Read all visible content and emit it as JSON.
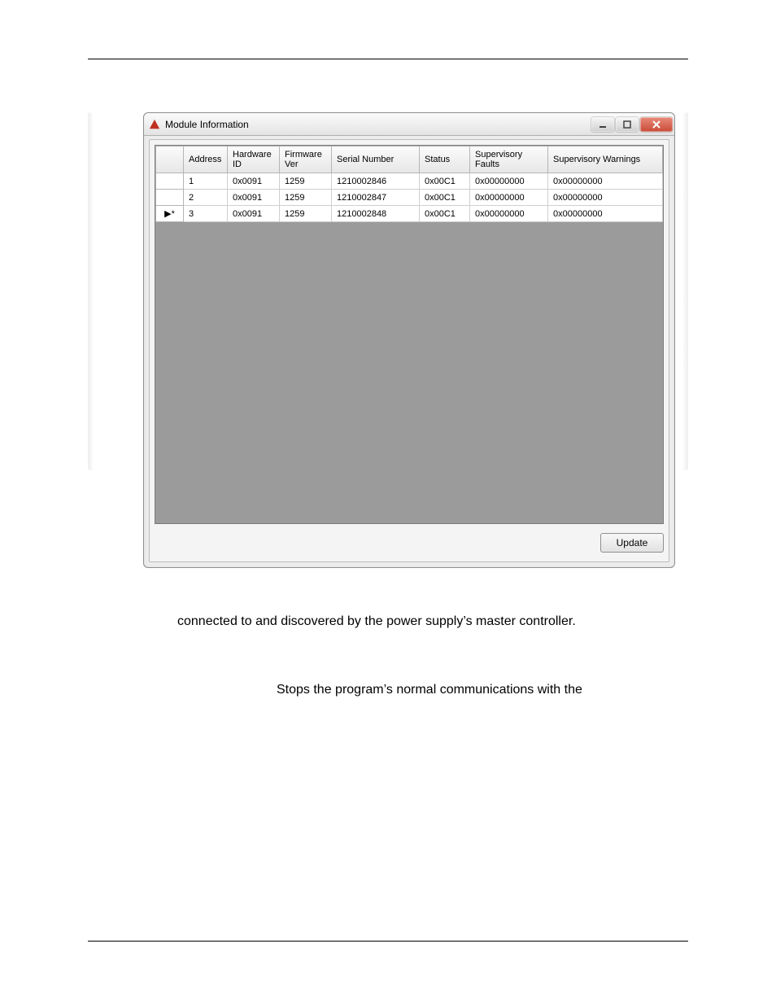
{
  "window": {
    "title": "Module Information",
    "update_button": "Update"
  },
  "columns": {
    "rowheader": "",
    "address": "Address",
    "hardware_id": "Hardware ID",
    "firmware_ver": "Firmware Ver",
    "serial_number": "Serial Number",
    "status": "Status",
    "supervisory_faults": "Supervisory Faults",
    "supervisory_warnings": "Supervisory Warnings"
  },
  "rows": [
    {
      "marker": "",
      "address": "1",
      "hardware_id": "0x0091",
      "firmware_ver": "1259",
      "serial_number": "1210002846",
      "status": "0x00C1",
      "supervisory_faults": "0x00000000",
      "supervisory_warnings": "0x00000000"
    },
    {
      "marker": "",
      "address": "2",
      "hardware_id": "0x0091",
      "firmware_ver": "1259",
      "serial_number": "1210002847",
      "status": "0x00C1",
      "supervisory_faults": "0x00000000",
      "supervisory_warnings": "0x00000000"
    },
    {
      "marker": "▶*",
      "address": "3",
      "hardware_id": "0x0091",
      "firmware_ver": "1259",
      "serial_number": "1210002848",
      "status": "0x00C1",
      "supervisory_faults": "0x00000000",
      "supervisory_warnings": "0x00000000"
    }
  ],
  "body_text": {
    "line1": "connected to and discovered by the power supply’s master controller.",
    "line2": "Stops the program’s normal communications with the"
  }
}
